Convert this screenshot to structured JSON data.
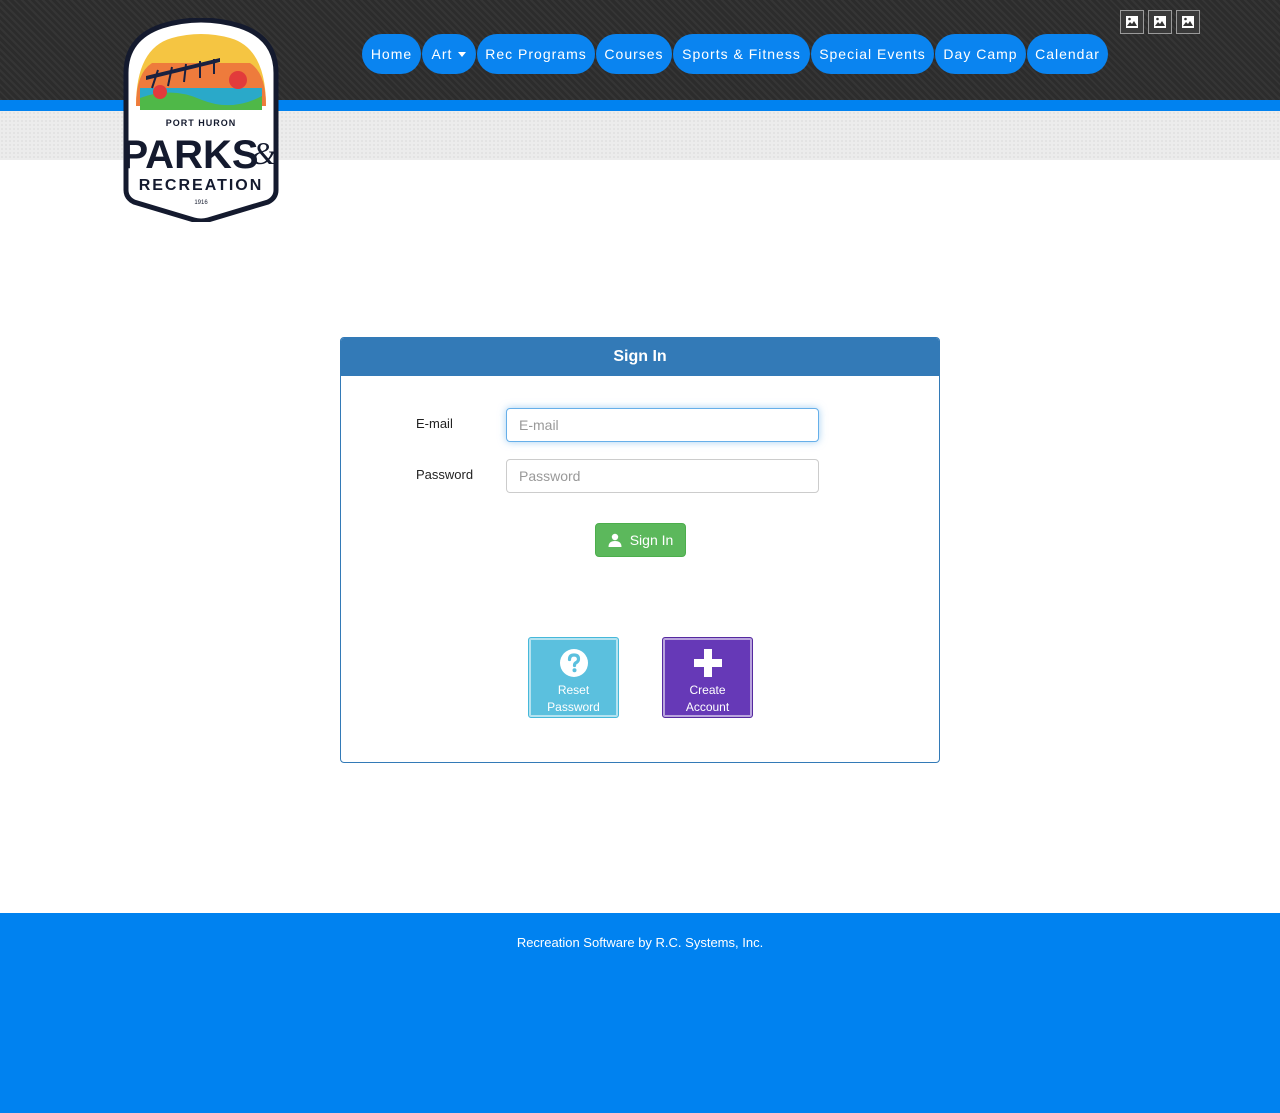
{
  "header": {
    "util_icons": [
      "image-icon",
      "image-icon",
      "image-icon"
    ],
    "nav": [
      {
        "label": "Home",
        "has_caret": false
      },
      {
        "label": "Art",
        "has_caret": true
      },
      {
        "label": "Rec Programs",
        "has_caret": false
      },
      {
        "label": "Courses",
        "has_caret": false
      },
      {
        "label": "Sports & Fitness",
        "has_caret": false
      },
      {
        "label": "Special Events",
        "has_caret": false
      },
      {
        "label": "Day Camp",
        "has_caret": false
      },
      {
        "label": "Calendar",
        "has_caret": false
      }
    ]
  },
  "logo": {
    "top_text": "PORT HURON",
    "main_text": "PARKS",
    "amp_text": "&",
    "sub_text": "RECREATION",
    "year_text": "1916"
  },
  "signin": {
    "title": "Sign In",
    "email_label": "E-mail",
    "email_placeholder": "E-mail",
    "email_value": "",
    "password_label": "Password",
    "password_placeholder": "Password",
    "password_value": "",
    "submit_label": "Sign In",
    "reset_label_1": "Reset",
    "reset_label_2": "Password",
    "create_label_1": "Create",
    "create_label_2": "Account"
  },
  "footer": {
    "text": "Recreation Software by R.C. Systems, Inc."
  },
  "colors": {
    "nav": "#0a84f0",
    "brand_blue": "#0082f0",
    "panel": "#337ab7",
    "success": "#5cb85c",
    "info": "#5bc0de",
    "purple": "#6639b7"
  }
}
